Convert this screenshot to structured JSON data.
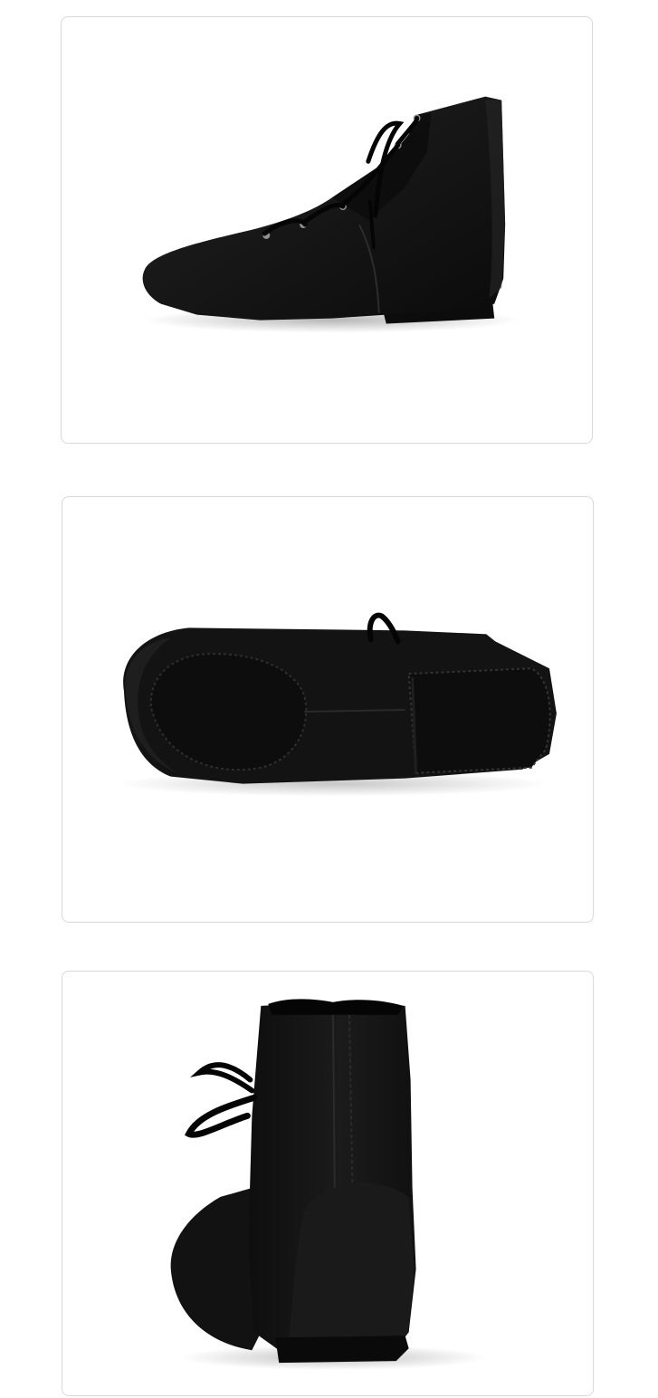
{
  "panels": [
    {
      "view": "side",
      "subject": "shoe"
    },
    {
      "view": "sole",
      "subject": "shoe"
    },
    {
      "view": "back",
      "subject": "shoe"
    }
  ],
  "colors": {
    "background": "#ffffff",
    "panel_border": "#d9d9d9",
    "shoe_fabric": "#151515",
    "shoe_shadow": "#0a0a0a",
    "shoe_highlight": "#2a2a2a",
    "stitching": "#3a3a3a",
    "eyelet": "#9a9a9a"
  }
}
